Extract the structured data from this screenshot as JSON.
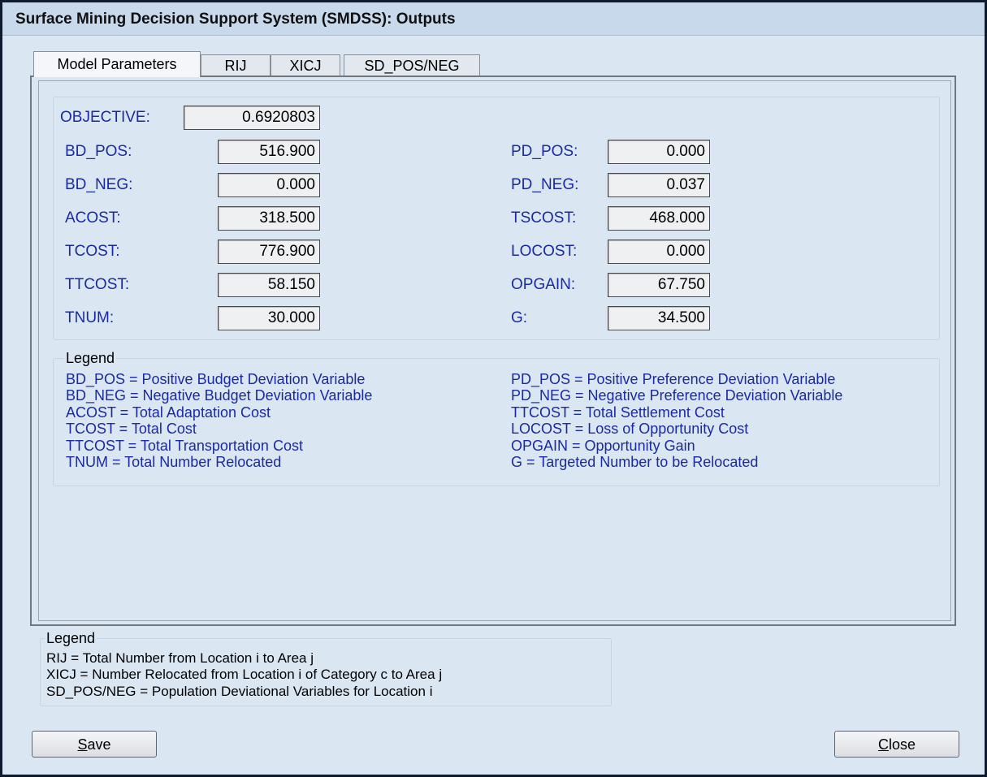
{
  "window": {
    "title": "Surface Mining Decision Support System (SMDSS): Outputs"
  },
  "tabs": [
    {
      "label": "Model Parameters"
    },
    {
      "label": "RIJ"
    },
    {
      "label": "XICJ"
    },
    {
      "label": "SD_POS/NEG"
    }
  ],
  "objective": {
    "label": "OBJECTIVE:",
    "value": "0.6920803"
  },
  "left_params": [
    {
      "label": "BD_POS:",
      "value": "516.900"
    },
    {
      "label": "BD_NEG:",
      "value": "0.000"
    },
    {
      "label": "ACOST:",
      "value": "318.500"
    },
    {
      "label": "TCOST:",
      "value": "776.900"
    },
    {
      "label": "TTCOST:",
      "value": "58.150"
    },
    {
      "label": "TNUM:",
      "value": "30.000"
    }
  ],
  "right_params": [
    {
      "label": "PD_POS:",
      "value": "0.000"
    },
    {
      "label": "PD_NEG:",
      "value": "0.037"
    },
    {
      "label": "TSCOST:",
      "value": "468.000"
    },
    {
      "label": "LOCOST:",
      "value": "0.000"
    },
    {
      "label": "OPGAIN:",
      "value": "67.750"
    },
    {
      "label": "G:",
      "value": "34.500"
    }
  ],
  "legend1": {
    "title": "Legend",
    "left": [
      "BD_POS = Positive Budget Deviation Variable",
      "BD_NEG = Negative Budget Deviation Variable",
      "ACOST = Total Adaptation Cost",
      "TCOST = Total Cost",
      "TTCOST = Total Transportation Cost",
      "TNUM = Total Number Relocated"
    ],
    "right": [
      "PD_POS = Positive Preference Deviation Variable",
      "PD_NEG = Negative Preference Deviation Variable",
      "TTCOST = Total Settlement Cost",
      "LOCOST = Loss of Opportunity Cost",
      "OPGAIN = Opportunity Gain",
      "G = Targeted Number to be Relocated"
    ]
  },
  "legend2": {
    "title": "Legend",
    "lines": [
      "RIJ = Total Number from Location i to Area j",
      "XICJ = Number Relocated from Location i of Category c to Area j",
      "SD_POS/NEG = Population Deviational Variables for Location i"
    ]
  },
  "buttons": {
    "save": {
      "mnemonic": "S",
      "rest": "ave"
    },
    "close": {
      "mnemonic": "C",
      "rest": "lose"
    }
  }
}
